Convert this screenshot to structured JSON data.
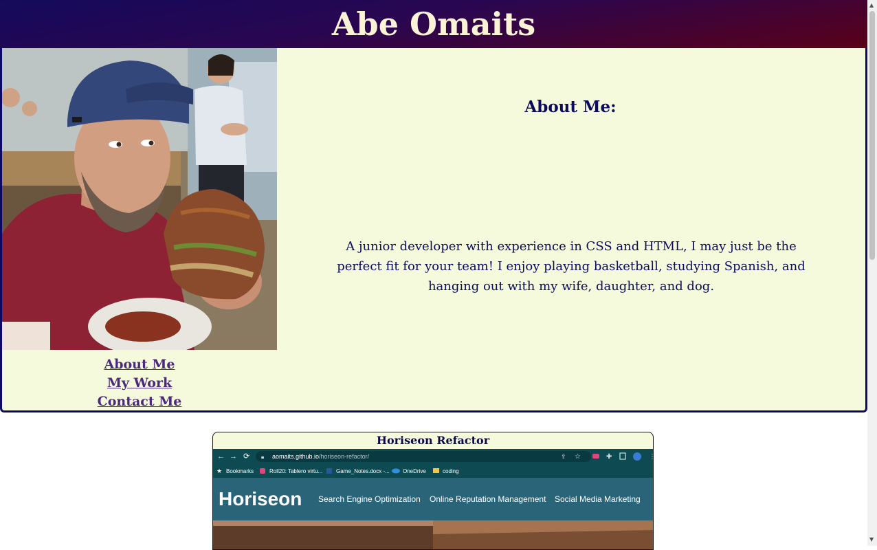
{
  "header": {
    "title": "Abe Omaits"
  },
  "about": {
    "heading": "About Me:",
    "text": "A junior developer with experience in CSS and HTML, I may just be the perfect fit for your team! I enjoy playing basketball, studying Spanish, and hanging out with my wife, daughter, and dog."
  },
  "nav": {
    "about_me": "About Me",
    "my_work": "My Work",
    "contact_me": "Contact Me"
  },
  "project": {
    "title": "Horiseon Refactor",
    "screenshot": {
      "url_host": "aomaits.github.io",
      "url_path": "/horiseon-refactor/",
      "bookmarks": [
        "Bookmarks",
        "Roll20: Tablero virtu...",
        "Game_Notes.docx -...",
        "OneDrive",
        "coding"
      ],
      "site_logo": "Horiseon",
      "site_nav": [
        "Search Engine Optimization",
        "Online Reputation Management",
        "Social Media Marketing"
      ]
    }
  },
  "colors": {
    "header_start": "#140a5c",
    "header_end": "#5a0018",
    "section_bg": "#f6fadc",
    "text_navy": "#0c0a5c",
    "link_purple": "#4a2a7d",
    "horiseon_teal": "#2a6478"
  }
}
